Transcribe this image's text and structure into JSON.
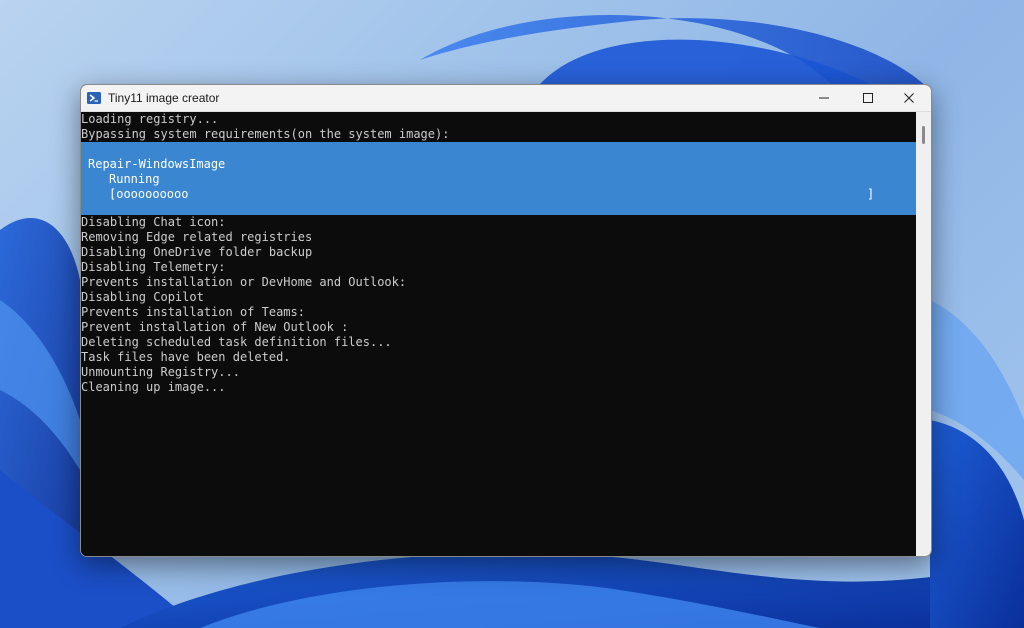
{
  "window": {
    "title": "Tiny11 image creator",
    "controls": {
      "minimize": "minimize-icon",
      "maximize": "maximize-icon",
      "close": "close-icon"
    }
  },
  "console": {
    "lines_before": [
      "Loading registry...",
      "Bypassing system requirements(on the system image):"
    ],
    "progress": {
      "activity": "Repair-WindowsImage",
      "status": "Running",
      "bar_text": "[oooooooooo",
      "bar_end": "]"
    },
    "lines_after": [
      "Disabling Chat icon:",
      "Removing Edge related registries",
      "Disabling OneDrive folder backup",
      "Disabling Telemetry:",
      "Prevents installation or DevHome and Outlook:",
      "Disabling Copilot",
      "Prevents installation of Teams:",
      "Prevent installation of New Outlook :",
      "Deleting scheduled task definition files...",
      "Task files have been deleted.",
      "Unmounting Registry...",
      "Cleaning up image..."
    ]
  },
  "colors": {
    "console_bg": "#0c0c0c",
    "console_text": "#cccccc",
    "progress_bg": "#3a86d0",
    "titlebar_bg": "#f3f3f3",
    "icon_blue": "#2a62b8"
  }
}
